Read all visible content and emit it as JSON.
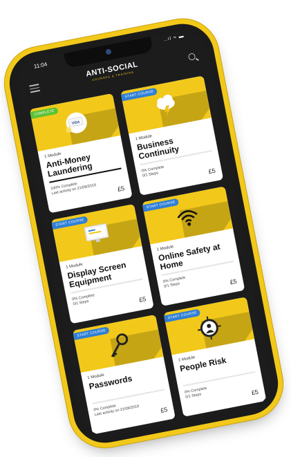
{
  "status": {
    "time": "11:04",
    "icons": "..ıl ≈ ▬"
  },
  "header": {
    "logo_main": "ANTI-SOCIAL",
    "logo_sub": "COURSES & TRAINING"
  },
  "colors": {
    "brand_yellow": "#f2c91a",
    "complete_green": "#5bc236",
    "start_blue": "#2f7fd6"
  },
  "cards": [
    {
      "badge": "COMPLETE",
      "modules": "1 Module",
      "title": "Anti-Money Laundering",
      "meta1": "100% Complete",
      "meta2": "Last activity on 21/08/2019",
      "price": "£5",
      "progress": 1.0,
      "icon": "visa-card-icon"
    },
    {
      "badge": "START COURSE",
      "modules": "1 Module",
      "title": "Business Continuity",
      "meta1": "0% Complete",
      "meta2": "0/1 Steps",
      "price": "£5",
      "progress": 0.0,
      "icon": "cloud-lightning-icon"
    },
    {
      "badge": "START COURSE",
      "modules": "1 Module",
      "title": "Display Screen Equipment",
      "meta1": "0% Complete",
      "meta2": "0/1 Steps",
      "price": "£5",
      "progress": 0.0,
      "icon": "monitor-icon"
    },
    {
      "badge": "START COURSE",
      "modules": "1 Module",
      "title": "Online Safety at Home",
      "meta1": "0% Complete",
      "meta2": "0/1 Steps",
      "price": "£5",
      "progress": 0.0,
      "icon": "wifi-icon"
    },
    {
      "badge": "START COURSE",
      "modules": "1 Module",
      "title": "Passwords",
      "meta1": "0% Complete",
      "meta2": "Last activity on 21/08/2019",
      "price": "£5",
      "progress": 0.0,
      "icon": "key-icon"
    },
    {
      "badge": "START COURSE",
      "modules": "1 Module",
      "title": "People Risk",
      "meta1": "0% Complete",
      "meta2": "0/1 Steps",
      "price": "£5",
      "progress": 0.0,
      "icon": "person-target-icon"
    }
  ]
}
